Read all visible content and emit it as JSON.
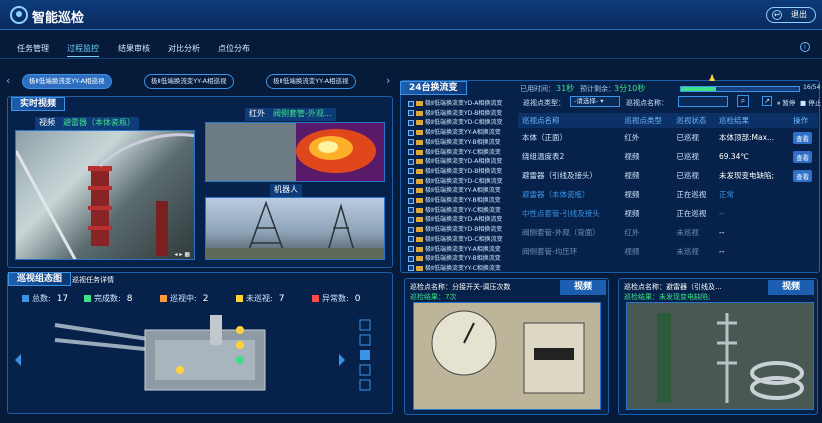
{
  "app": {
    "title": "智能巡检",
    "back_label": "退出"
  },
  "nav": [
    "任务管理",
    "过程监控",
    "结果审核",
    "对比分析",
    "点位分布"
  ],
  "tabs": [
    "极Ⅱ低端换流变YY-A相巡视",
    "极Ⅱ低端换流变YY-A相巡视",
    "极Ⅱ低端换流变YY-A相巡视"
  ],
  "realtime": {
    "title": "实时视频",
    "video_label": "视频",
    "video_point": "避雷器（本体瓷瓶）",
    "ir_label": "红外",
    "ir_point": "阀侧套管-外观...",
    "robot_label": "机器人"
  },
  "converter": {
    "title": "24台换流变",
    "elapsed_label": "已用时间：",
    "elapsed": "31秒",
    "remain_label": "预计剩余：",
    "remain": "3分10秒",
    "progress_text": "16/54",
    "progress": 0.3
  },
  "filters": {
    "type_label": "巡视点类型：",
    "type_placeholder": "-请选择-",
    "name_label": "巡视点名称：",
    "pause": "暂停",
    "stop": "停止"
  },
  "device_list": [
    "极Ⅱ低端换流变YD-A相换流变",
    "极Ⅱ低端换流变YD-B相换流变",
    "极Ⅱ低端换流变YD-C相换流变",
    "极Ⅱ低端换流变YY-A相换流变",
    "极Ⅱ低端换流变YY-B相换流变",
    "极Ⅱ低端换流变YY-C相换流变",
    "极Ⅱ低端换流变YD-A相换流变",
    "极Ⅱ低端换流变YD-B相换流变",
    "极Ⅱ低端换流变YD-C相换流变",
    "极Ⅱ低端换流变YY-A相换流变",
    "极Ⅱ低端换流变YY-B相换流变",
    "极Ⅱ低端换流变YY-C相换流变",
    "极Ⅱ低端换流变YD-A相换流变",
    "极Ⅱ低端换流变YD-B相换流变",
    "极Ⅱ低端换流变YD-C相换流变",
    "极Ⅱ低端换流变YY-A相换流变",
    "极Ⅱ低端换流变YY-B相换流变",
    "极Ⅱ低端换流变YY-C相换流变"
  ],
  "table": {
    "headers": [
      "巡视点名称",
      "巡视点类型",
      "巡视状态",
      "巡检结果",
      "操作"
    ],
    "rows": [
      {
        "name": "本体（正面）",
        "type": "红外",
        "status": "已巡视",
        "result": "本体顶部:Max...",
        "op": "查看"
      },
      {
        "name": "绕组温度表2",
        "type": "视频",
        "status": "已巡视",
        "result": "69.34℃",
        "op": "查看"
      },
      {
        "name": "避雷器（引线及接头）",
        "type": "视频",
        "status": "已巡视",
        "result": "未发现变电缺陷;",
        "op": "查看"
      },
      {
        "name": "避雷器（本体瓷瓶）",
        "type": "视频",
        "status": "正在巡视",
        "result": "正常",
        "op": ""
      },
      {
        "name": "中性点套管-引线及接头",
        "type": "视频",
        "status": "正在巡视",
        "result": "--",
        "op": ""
      },
      {
        "name": "阀侧套管-外观（背面）",
        "type": "红外",
        "status": "未巡视",
        "result": "--",
        "op": ""
      },
      {
        "name": "阀侧套管-均压环",
        "type": "视频",
        "status": "未巡视",
        "result": "--",
        "op": ""
      }
    ]
  },
  "diagram": {
    "title": "巡视组态图",
    "subtitle": "巡视任务详情",
    "total_label": "总数:",
    "total": "17",
    "done_label": "完成数:",
    "done": "8",
    "inprog_label": "巡视中:",
    "inprog": "2",
    "notyet_label": "未巡视:",
    "notyet": "7",
    "abnormal_label": "异常数:",
    "abnormal": "0"
  },
  "snap1": {
    "point_label": "巡检点名称：分接开关-调压次数",
    "result_label": "巡检结果：7次",
    "tag": "视频"
  },
  "snap2": {
    "point_label": "巡检点名称：避雷器（引线及...",
    "result_label": "巡检结果：未发现变电缺陷;",
    "tag": "视频"
  },
  "colors": {
    "accent": "#3a93e6",
    "green": "#3ee08a",
    "red": "#ff4a4a",
    "yellow": "#ffd23a"
  }
}
